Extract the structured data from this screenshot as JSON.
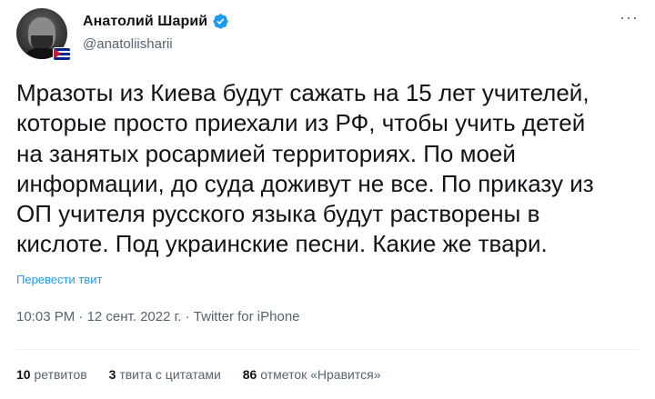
{
  "author": {
    "display_name": "Анатолий Шарий",
    "handle": "@anatoliisharii",
    "verified_icon": "verified-badge-icon",
    "avatar_flag_icon": "cuba-flag-icon"
  },
  "menu": {
    "more_label": "···"
  },
  "tweet": {
    "lines": [
      "Мразоты из Киева будут сажать на 15 лет учителей,",
      "которые просто приехали из РФ, чтобы учить детей",
      "на занятых росармией территориях. По моей",
      "информации, до суда доживут не все. По приказу из",
      "ОП учителя русского языка будут растворены в",
      "кислоте. Под украинские песни. Какие же твари."
    ],
    "translate_label": "Перевести твит",
    "time": "10:03 PM",
    "date": "12 сент. 2022 г.",
    "source": "Twitter for iPhone",
    "separator": " · "
  },
  "stats": {
    "retweets_count": "10",
    "retweets_label": "ретвитов",
    "quotes_count": "3",
    "quotes_label": "твита с цитатами",
    "likes_count": "86",
    "likes_label": "отметок «Нравится»"
  },
  "colors": {
    "accent": "#1d9bf0",
    "text_primary": "#0f1419",
    "text_secondary": "#536471"
  }
}
